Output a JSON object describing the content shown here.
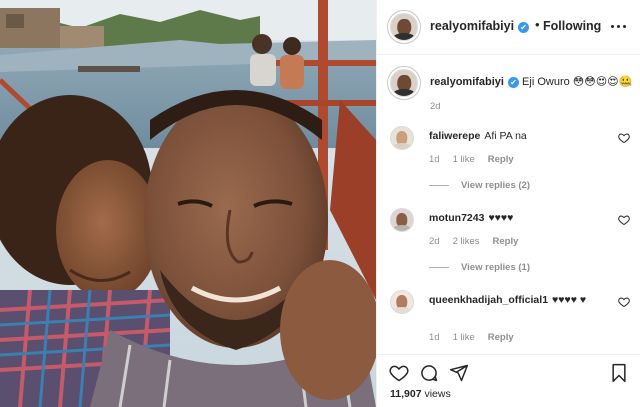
{
  "post": {
    "username": "realyomifabiyi",
    "verified_glyph": "✔",
    "separator": "•",
    "follow_label": "Following",
    "more_icon": "more-options-icon"
  },
  "caption": {
    "username": "realyomifabiyi",
    "text": "Eji Owuro 😳😳😍😍🤐",
    "time": "2d"
  },
  "comments": [
    {
      "username": "faliwerepe",
      "text": "Afi PA na",
      "time": "1d",
      "likes": "1 like",
      "reply_label": "Reply",
      "view_replies": "View replies (2)"
    },
    {
      "username": "motun7243",
      "text": "♥♥♥♥",
      "time": "2d",
      "likes": "2 likes",
      "reply_label": "Reply",
      "view_replies": "View replies (1)"
    },
    {
      "username": "queenkhadijah_official1",
      "text": "♥♥♥♥ ♥",
      "time": "1d",
      "likes": "1 like",
      "reply_label": "Reply"
    }
  ],
  "actions": {
    "like_icon": "heart-icon",
    "comment_icon": "comment-icon",
    "share_icon": "share-icon",
    "save_icon": "bookmark-icon",
    "views_count": "11,907",
    "views_label": "views"
  },
  "colors": {
    "text": "#262626",
    "muted": "#8e8e8e",
    "verified": "#3897f0",
    "border": "#efefef"
  }
}
